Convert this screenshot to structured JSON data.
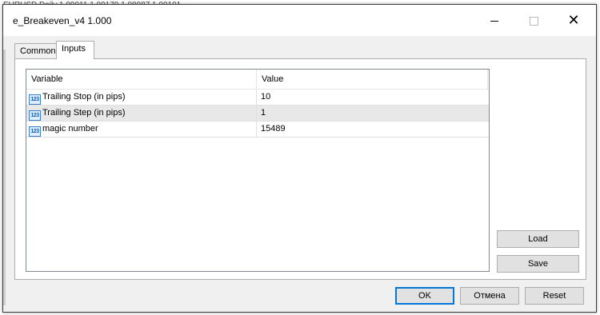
{
  "window": {
    "title": "e_Breakeven_v4 1.000",
    "background_title": "EURUSD,Daily 1.09011 1.09179 1.08987 1.09101"
  },
  "tabs": [
    {
      "label": "Common",
      "selected": false
    },
    {
      "label": "Inputs",
      "selected": true
    }
  ],
  "grid": {
    "headers": {
      "variable": "Variable",
      "value": "Value"
    },
    "rows": [
      {
        "icon": "123",
        "variable": "Trailing Stop (in pips)",
        "value": "10"
      },
      {
        "icon": "123",
        "variable": "Trailing Step (in pips)",
        "value": "1"
      },
      {
        "icon": "123",
        "variable": "magic number",
        "value": "15489"
      }
    ]
  },
  "side_buttons": {
    "load": "Load",
    "save": "Save"
  },
  "bottom_buttons": {
    "ok": "OK",
    "cancel": "Отмена",
    "reset": "Reset"
  },
  "colors": {
    "accent": "#0078d7",
    "selected_row": "#e8e8e8",
    "dialog_bg": "#f0f0f0"
  }
}
